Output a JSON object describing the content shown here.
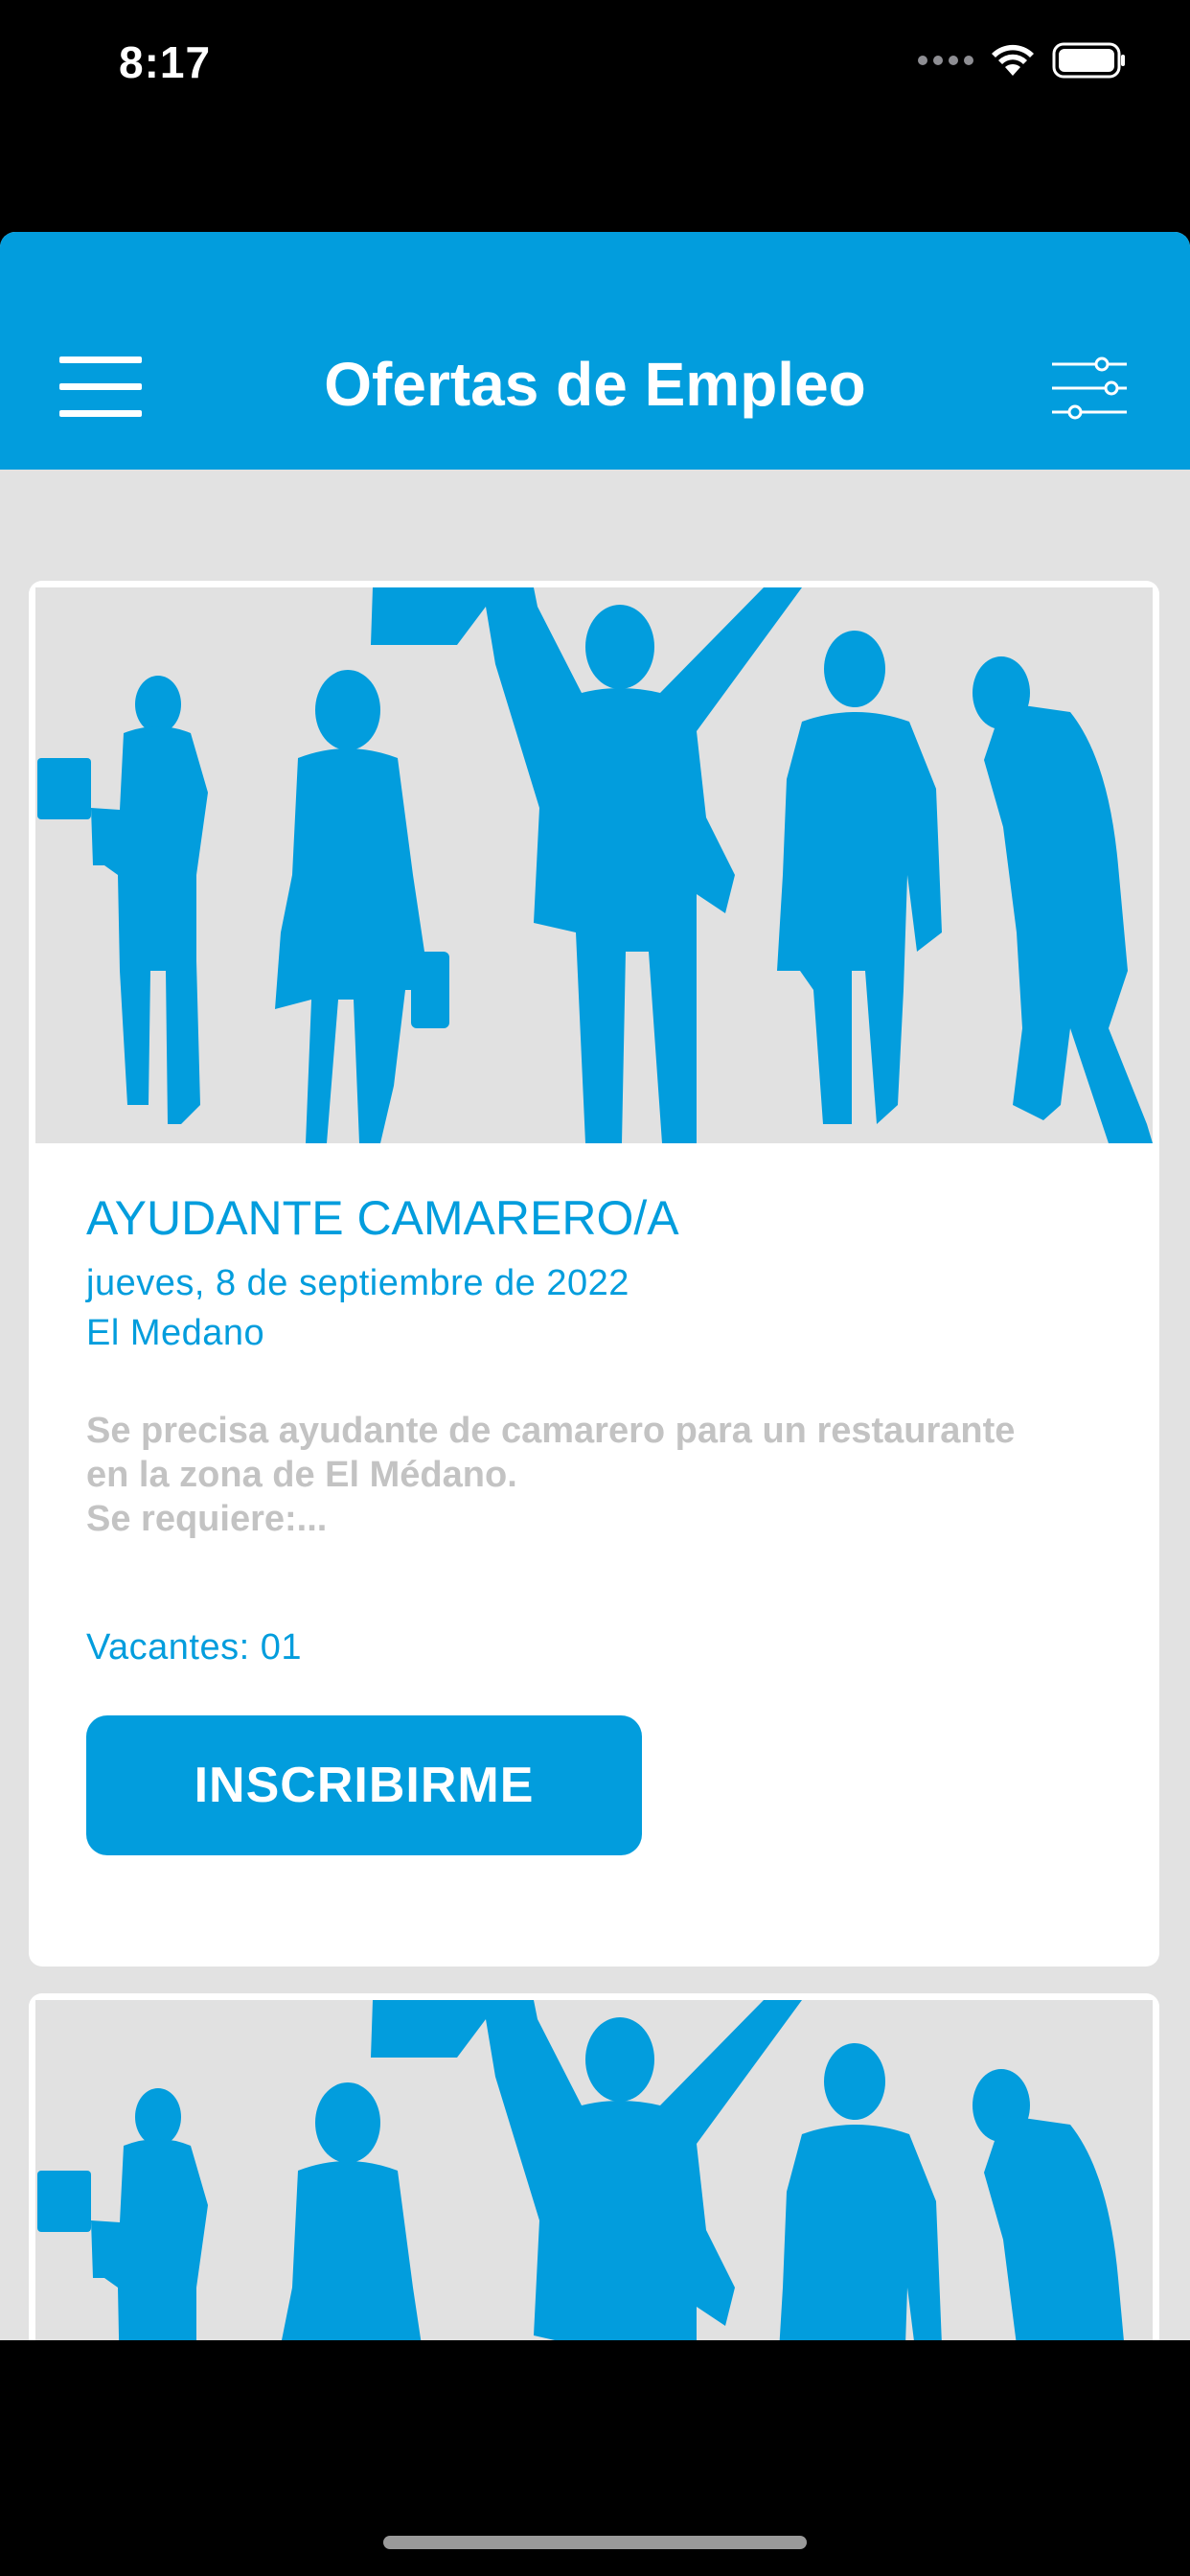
{
  "status_bar": {
    "time": "8:17"
  },
  "navbar": {
    "title": "Ofertas de Empleo",
    "menu_icon": "hamburger-menu-icon",
    "filter_icon": "sliders-filter-icon"
  },
  "colors": {
    "accent": "#029ddd",
    "background": "#e2e2e2",
    "description_text": "#c3c3c3"
  },
  "jobs": [
    {
      "image": "people-silhouettes-image",
      "title": "AYUDANTE CAMARERO/A",
      "date": "jueves, 8 de septiembre de 2022",
      "location": "El Medano",
      "description": "Se precisa ayudante de camarero para un restaurante\nen la zona de El Médano.\nSe requiere:...",
      "vacancies": "Vacantes: 01",
      "button_label": "INSCRIBIRME"
    },
    {
      "image": "people-silhouettes-image"
    }
  ]
}
